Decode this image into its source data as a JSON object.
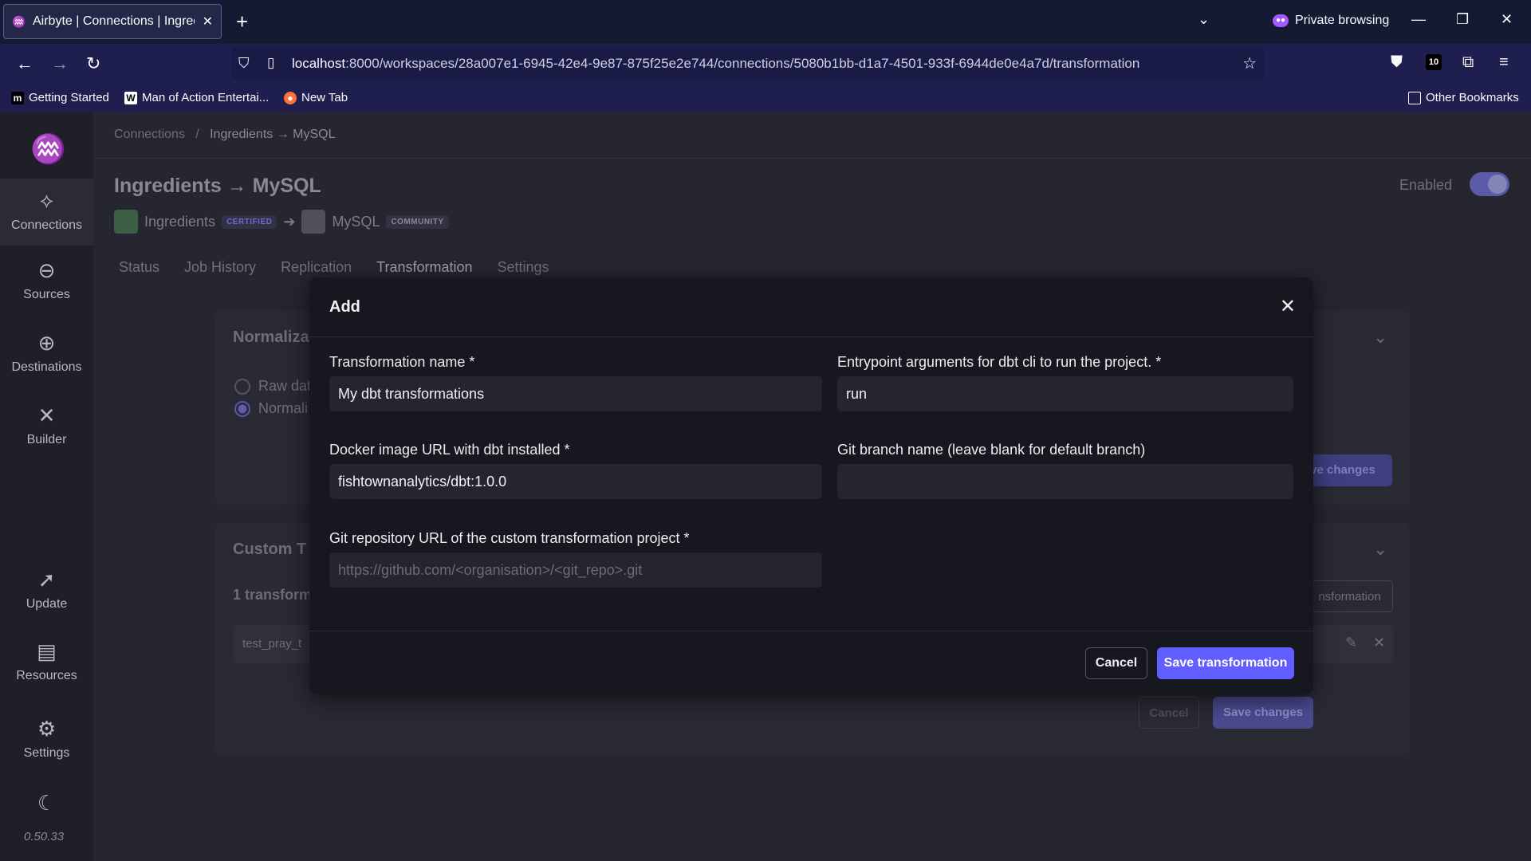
{
  "browser": {
    "tab_title": "Airbyte | Connections | Ingredie",
    "private_label": "Private browsing",
    "url_host": "localhost",
    "url_path": ":8000/workspaces/28a007e1-6945-42e4-9e87-875f25e2e744/connections/5080b1bb-d1a7-4501-933f-6944de0e4a7d/transformation",
    "extension_badge": "10",
    "bookmarks": [
      "Getting Started",
      "Man of Action Entertai...",
      "New Tab"
    ],
    "other_bookmarks": "Other Bookmarks"
  },
  "sidebar": {
    "items": [
      {
        "label": "Connections",
        "icon": "connections-icon"
      },
      {
        "label": "Sources",
        "icon": "sources-icon"
      },
      {
        "label": "Destinations",
        "icon": "destinations-icon"
      },
      {
        "label": "Builder",
        "icon": "builder-icon"
      },
      {
        "label": "Update",
        "icon": "rocket-icon"
      },
      {
        "label": "Resources",
        "icon": "resources-icon"
      },
      {
        "label": "Settings",
        "icon": "gear-icon"
      }
    ],
    "version": "0.50.33"
  },
  "page": {
    "breadcrumb_root": "Connections",
    "breadcrumb_sep": "/",
    "breadcrumb_current": "Ingredients → MySQL",
    "title": "Ingredients → MySQL",
    "enabled_label": "Enabled",
    "source_name": "Ingredients",
    "source_badge": "CERTIFIED",
    "dest_name": "MySQL",
    "dest_badge": "COMMUNITY",
    "tabs": [
      "Status",
      "Job History",
      "Replication",
      "Transformation",
      "Settings"
    ],
    "normalization_title": "Normaliza",
    "radio_raw": "Raw dat",
    "radio_norm": "Normali",
    "save_changes": "ve changes",
    "custom_title": "Custom T",
    "transform_count": "1 transform",
    "transform_btn": "nsformation",
    "transform_item": "test_pray_t",
    "cancel_label": "Cancel",
    "save_changes_full": "Save changes"
  },
  "modal": {
    "title": "Add",
    "name_label": "Transformation name *",
    "name_value": "My dbt transformations",
    "entry_label": "Entrypoint arguments for dbt cli to run the project. *",
    "entry_value": "run",
    "docker_label": "Docker image URL with dbt installed *",
    "docker_value": "fishtownanalytics/dbt:1.0.0",
    "branch_label": "Git branch name (leave blank for default branch)",
    "branch_value": "",
    "repo_label": "Git repository URL of the custom transformation project *",
    "repo_placeholder": "https://github.com/<organisation>/<git_repo>.git",
    "cancel": "Cancel",
    "save": "Save transformation"
  },
  "colors": {
    "accent": "#615eff",
    "modal_bg": "#171720",
    "input_bg": "#25252f"
  }
}
